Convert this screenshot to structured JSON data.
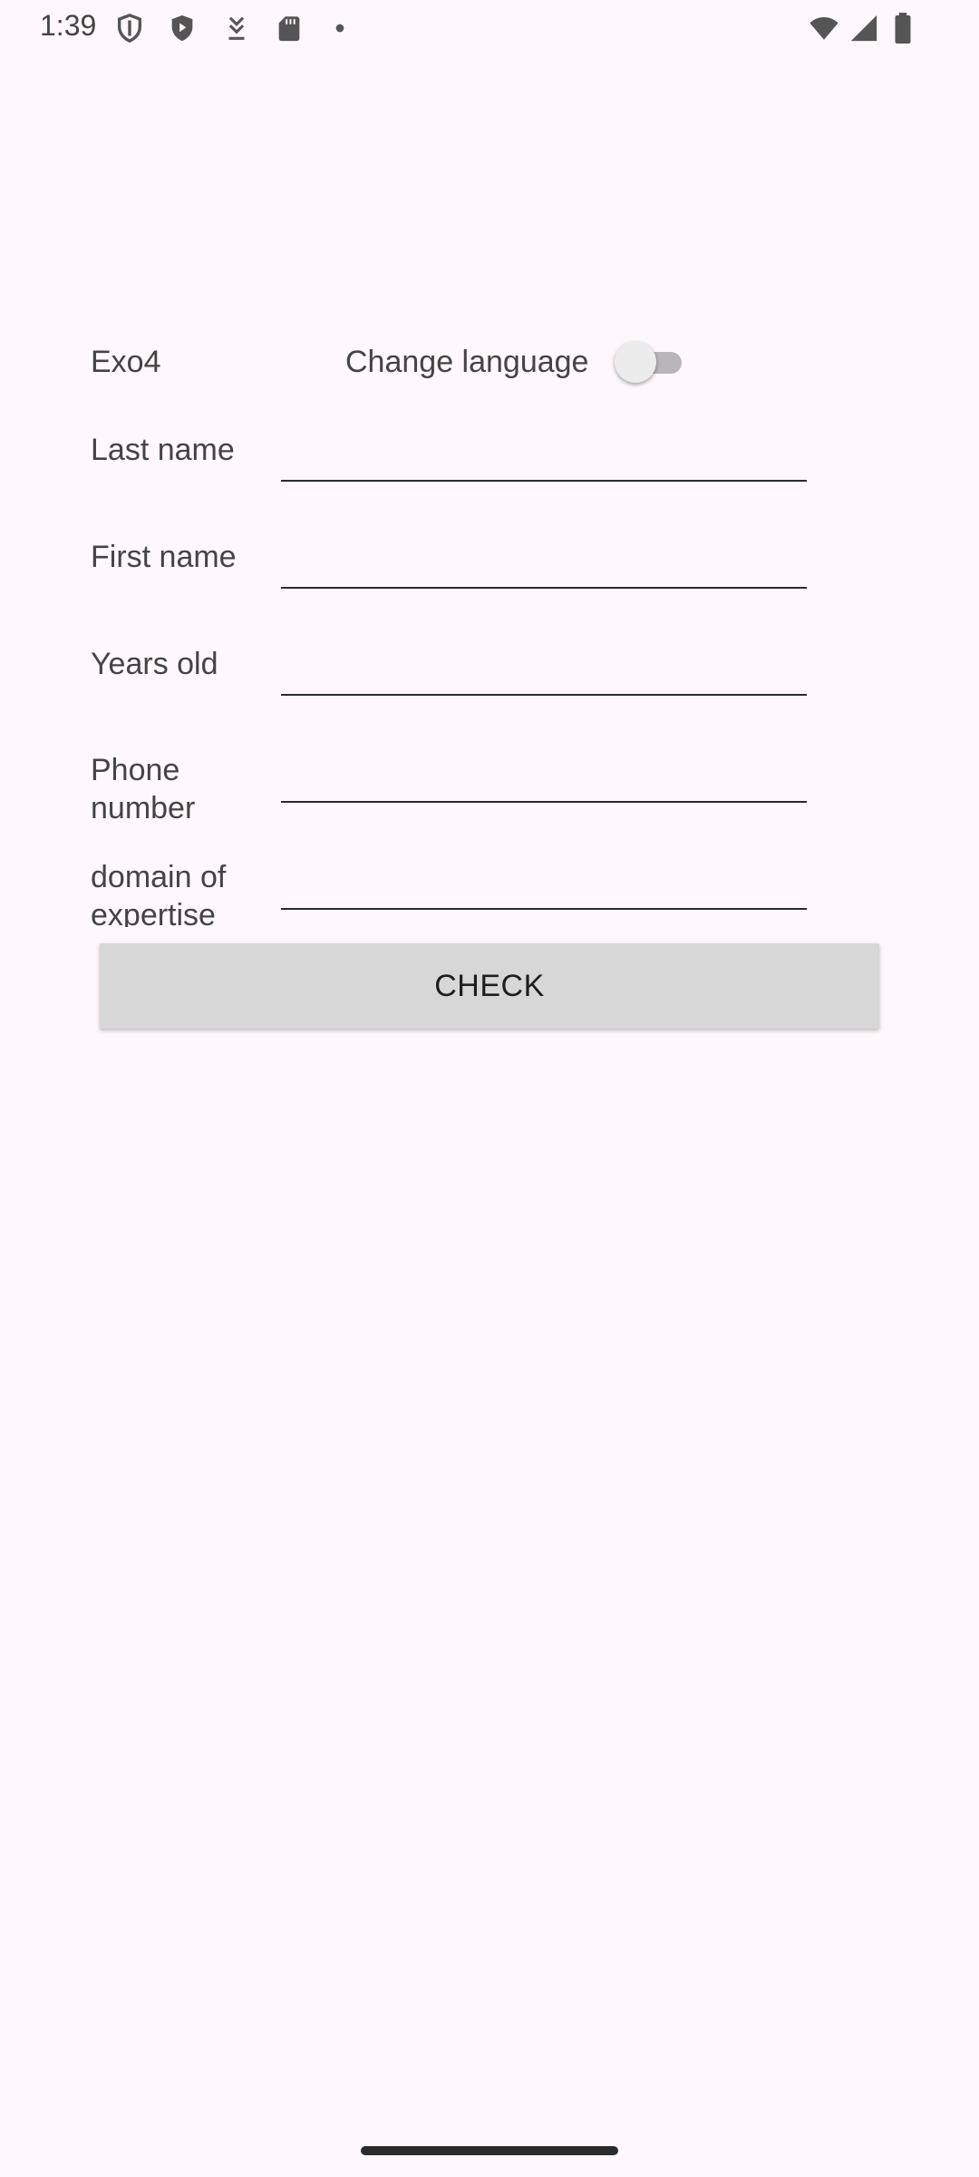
{
  "status_bar": {
    "time": "1:39",
    "left_icons": [
      "shield-outline-icon",
      "shield-play-icon",
      "download-icon",
      "sd-card-icon",
      "dot-icon"
    ],
    "right_icons": [
      "wifi-icon",
      "signal-icon",
      "battery-icon"
    ]
  },
  "header": {
    "app_label": "Exo4",
    "language_switch_label": "Change language",
    "language_switch_on": false
  },
  "form": {
    "last_name": {
      "label": "Last name",
      "value": ""
    },
    "first_name": {
      "label": "First name",
      "value": ""
    },
    "years_old": {
      "label": "Years old",
      "value": ""
    },
    "phone_number": {
      "label": "Phone number",
      "value": ""
    },
    "domain_of_expertise": {
      "label": "domain of expertise",
      "value": ""
    },
    "check_label": "CHECK"
  },
  "colors": {
    "background": "#fef7fb",
    "button": "#d6d7d6",
    "text": "#444444"
  }
}
